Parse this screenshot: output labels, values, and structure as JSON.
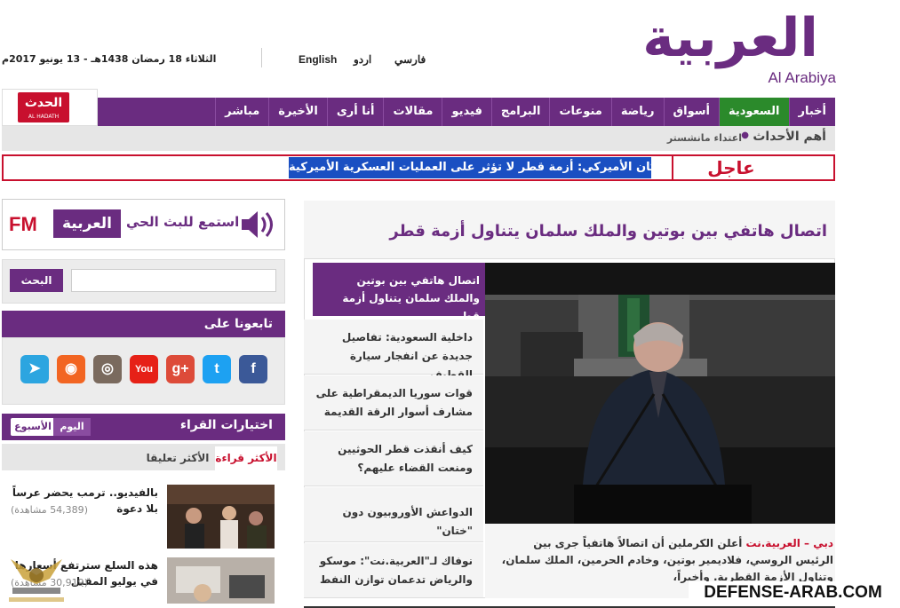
{
  "header": {
    "logo_ar": "العربية",
    "logo_en": "Al Arabiya",
    "date": "الثلاثاء 18 رمضان 1438هـ - 13 يونيو 2017م",
    "languages": [
      "فارسي",
      "اردو",
      "English"
    ]
  },
  "nav": {
    "items": [
      "أخبار",
      "السعودية",
      "أسواق",
      "رياضة",
      "منوعات",
      "البرامج",
      "فيديو",
      "مقالات",
      "أنا أرى",
      "الأخيرة",
      "مباشر"
    ],
    "active_index": 1,
    "hadath_logo": "الحدث",
    "hadath_sub": "AL HADATH"
  },
  "top_stories": {
    "label": "أهم الأحداث",
    "item": "اعتداء مانشستر"
  },
  "breaking": {
    "label": "عاجل",
    "text": "رئيس الأركان الأميركي: أزمة قطر لا تؤثر على العمليات العسكرية الأميركية"
  },
  "sidebar": {
    "fm_label": "FM",
    "fm_logo": "العربية",
    "fm_listen": "استمع للبث الحي",
    "search_button": "البحث",
    "search_placeholder": "",
    "follow_title": "تابعونا على",
    "social_icons": [
      "facebook-icon",
      "twitter-icon",
      "google-plus-icon",
      "youtube-icon",
      "instagram-icon",
      "rss-icon",
      "telegram-icon"
    ],
    "social_glyphs": [
      "f",
      "t",
      "g+",
      "You",
      "◎",
      "◉",
      "➤"
    ],
    "social_colors": [
      "#3b5998",
      "#1da1f2",
      "#dd4b39",
      "#e62117",
      "#7a6a5e",
      "#f26522",
      "#2ca5e0"
    ],
    "picks_title": "اختيارات القراء",
    "picks_today": "اليوم",
    "picks_week": "الأسبوع",
    "tab_most_read": "الأكثر قراءة",
    "tab_most_comment": "الأكثر تعليقا",
    "picks": [
      {
        "title": "بالفيديو.. ترمب يحضر عرساً بلا دعوة",
        "views": "(54,389 مشاهدة)"
      },
      {
        "title": "هذه السلع سترتفع أسعارها في يوليو المقبل",
        "views": "(30,919 مشاهدة)"
      }
    ]
  },
  "main": {
    "headline": "اتصال هاتفي بين بوتين والملك سلمان يتناول أزمة قطر",
    "active_story": "اتصال هاتفي بين بوتين والملك سلمان يتناول أزمة قطر",
    "stories": [
      "داخلية السعودية: تفاصيل جديدة عن انفجار سيارة القطيف",
      "قوات سوريا الديمقراطية على مشارف أسوار الرقة القديمة",
      "كيف أنقذت قطر الحوثيين ومنعت القضاء عليهم؟",
      "الدواعش الأوروبيون دون \"ختان\"",
      "نوفاك لـ\"العربية.نت\": موسكو والرياض تدعمان توازن النفط"
    ],
    "caption_source": "دبي – العربية.نت",
    "caption_text": " أعلن الكرملين أن اتصالاً هاتفياً جرى بين الرئيس الروسي، فلاديمير بوتين، وخادم الحرمين، الملك سلمان، وتناول الأزمة القطرية. وأخيراً،"
  },
  "watermark": "DEFENSE-ARAB.COM",
  "colors": {
    "brand_purple": "#6a2c80",
    "breaking_red": "#c8102e",
    "active_green": "#2b8a2b",
    "highlight_blue": "#1a4fc2"
  }
}
